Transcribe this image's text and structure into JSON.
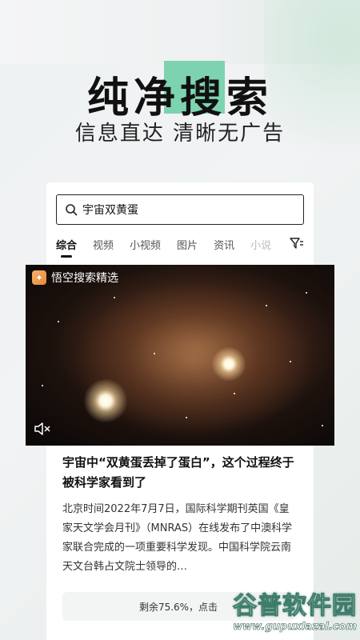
{
  "hero": {
    "title_part1": "纯净",
    "title_highlight": "搜",
    "title_part2": "索",
    "subtitle": "信息直达 清晰无广告",
    "highlight_color": "#7dd3b0"
  },
  "search": {
    "query": "宇宙双黄蛋"
  },
  "tabs": [
    "综合",
    "视频",
    "小视频",
    "图片",
    "资讯",
    "小说"
  ],
  "active_tab": "综合",
  "video": {
    "badge": "悟空搜索精选"
  },
  "article": {
    "title": "宇宙中“双黄蛋丢掉了蛋白”，这个过程终于被科学家看到了",
    "body": "北京时间2022年7月7日，国际科学期刊英国《皇家天文学会月刊》（MNRAS）在线发布了中澳科学家联合完成的一项重要科学发现。中国科学院云南天文台韩占文院士领导的…"
  },
  "progress": {
    "text": "剩余75.6%，点击",
    "remaining_percent": 75.6
  },
  "watermark": {
    "main": "谷普软件园",
    "url": "www.gupuxlazal.com"
  },
  "icons": {
    "search": "search-icon",
    "filter": "filter-icon",
    "mute": "mute-icon",
    "badge": "wukong-logo-icon"
  }
}
